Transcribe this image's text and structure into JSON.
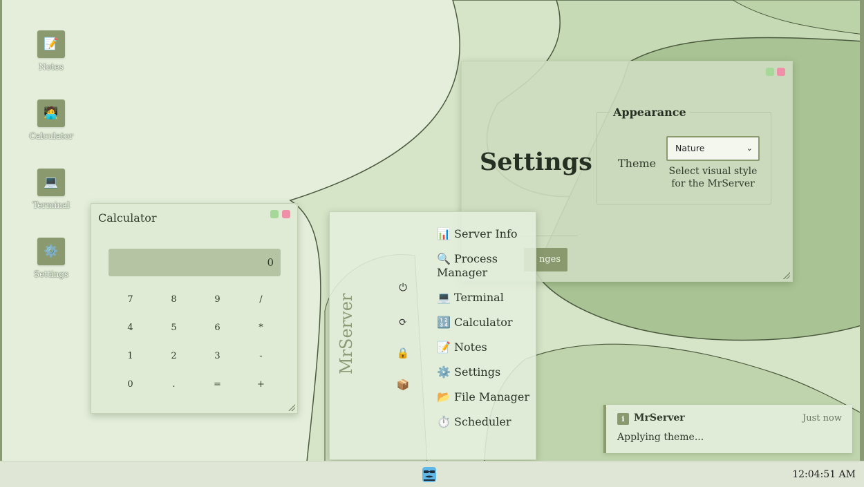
{
  "desktop": {
    "icons": [
      {
        "label": "Notes",
        "glyph": "📝",
        "icon": "notes-icon"
      },
      {
        "label": "Calculator",
        "glyph": "🧑‍💻",
        "icon": "calculator-icon"
      },
      {
        "label": "Terminal",
        "glyph": "💻",
        "icon": "terminal-icon"
      },
      {
        "label": "Settings",
        "glyph": "⚙️",
        "icon": "settings-icon"
      }
    ]
  },
  "calculator": {
    "title": "Calculator",
    "display": "0",
    "keys": [
      "7",
      "8",
      "9",
      "/",
      "4",
      "5",
      "6",
      "*",
      "1",
      "2",
      "3",
      "-",
      "0",
      ".",
      "=",
      "+"
    ]
  },
  "settings": {
    "heading": "Settings",
    "section": "Appearance",
    "theme_label": "Theme",
    "theme_value": "Nature",
    "hint": "Select visual style for the MrServer",
    "apply_partial": "nges"
  },
  "menu": {
    "brand": "MrServer",
    "power_icons": [
      {
        "glyph": "⏻",
        "icon": "power-icon"
      },
      {
        "glyph": "⟳",
        "icon": "restart-icon"
      },
      {
        "glyph": "🔒",
        "icon": "lock-icon"
      },
      {
        "glyph": "📦",
        "icon": "package-icon"
      }
    ],
    "items": [
      "📊 Server Info",
      "🔍 Process Manager",
      "💻 Terminal",
      "🔢 Calculator",
      "📝 Notes",
      "⚙️ Settings",
      "📂 File Manager",
      "⏱️ Scheduler"
    ]
  },
  "notification": {
    "icon": "ℹ",
    "app": "MrServer",
    "time": "Just now",
    "message": "Applying theme..."
  },
  "taskbar": {
    "clock": "12:04:51 AM"
  },
  "colors": {
    "accent": "#8a9a6e",
    "wallpaper_light": "#e4eedb",
    "wallpaper_dark": "#9cb485"
  }
}
